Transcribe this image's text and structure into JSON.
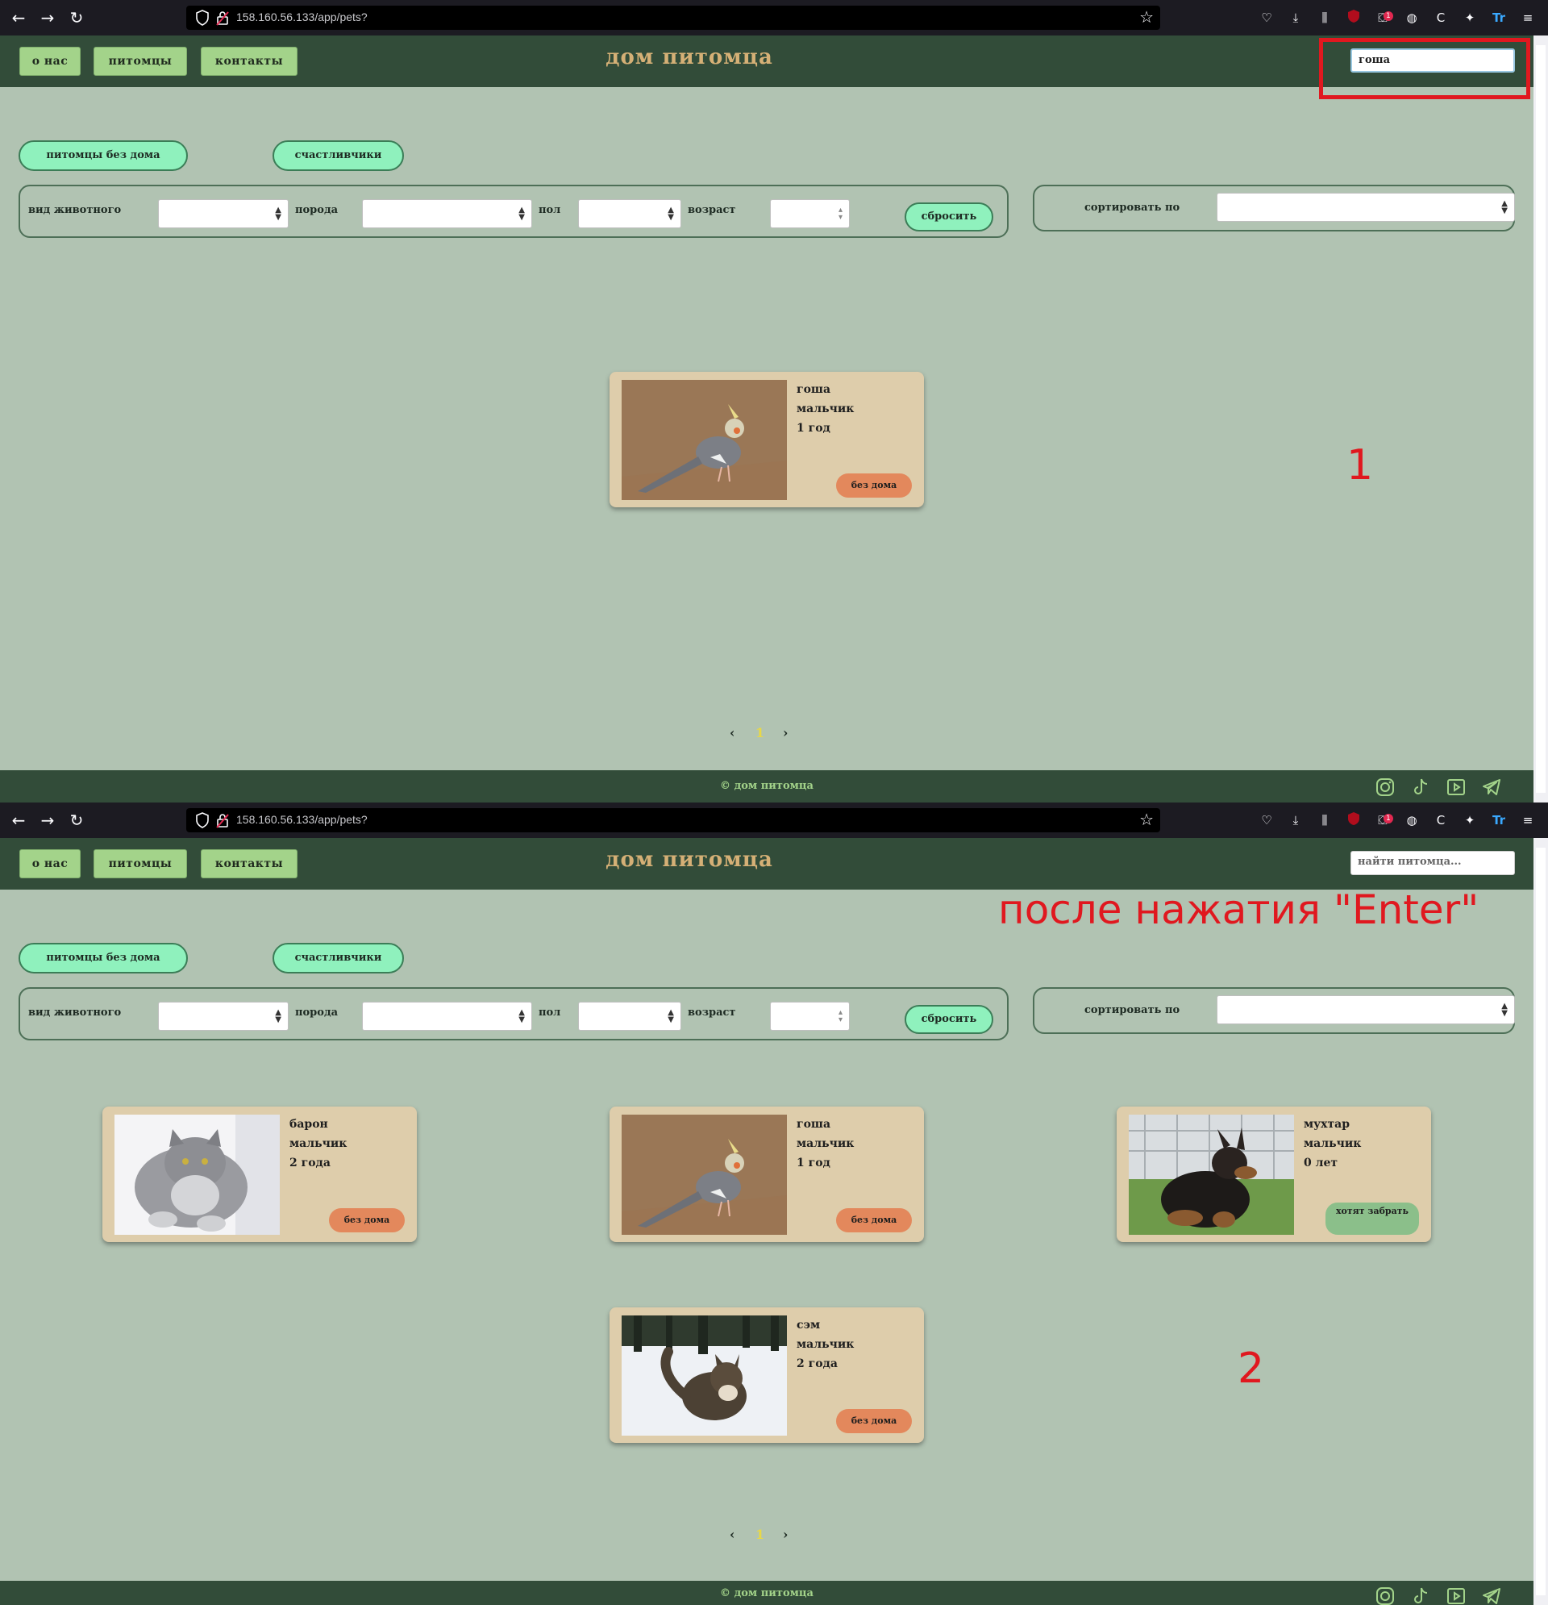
{
  "browser": {
    "url": "158.160.56.133/app/pets?",
    "extension_badge": "1"
  },
  "site": {
    "title": "дом питомца",
    "nav": [
      "о нас",
      "питомцы",
      "контакты"
    ],
    "tabs": [
      "питомцы без дома",
      "счастливчики"
    ],
    "filters": {
      "animal_type_label": "вид животного",
      "breed_label": "порода",
      "sex_label": "пол",
      "age_label": "возраст",
      "reset_label": "сбросить"
    },
    "sort_label": "сортировать по",
    "pager": {
      "prev": "‹",
      "current": "1",
      "next": "›"
    },
    "footer": "© дом питомца",
    "social_icons": [
      "instagram-icon",
      "tiktok-icon",
      "youtube-icon",
      "telegram-icon"
    ]
  },
  "panel1": {
    "search_value": "гоша",
    "annotation": "1",
    "cards": [
      {
        "name": "гоша",
        "sex": "мальчик",
        "age": "1 год",
        "status": "без дома",
        "image": "cockatiel"
      }
    ]
  },
  "panel2": {
    "search_placeholder": "найти питомца...",
    "annotation_title": "после нажатия \"Enter\"",
    "annotation": "2",
    "cards": [
      {
        "name": "барон",
        "sex": "мальчик",
        "age": "2 года",
        "status": "без дома",
        "image": "fluffy-cat"
      },
      {
        "name": "гоша",
        "sex": "мальчик",
        "age": "1 год",
        "status": "без дома",
        "image": "cockatiel"
      },
      {
        "name": "мухтар",
        "sex": "мальчик",
        "age": "0 лет",
        "status": "хотят забрать",
        "image": "shepherd-puppy"
      },
      {
        "name": "сэм",
        "sex": "мальчик",
        "age": "2 года",
        "status": "без дома",
        "image": "cat-in-snow"
      }
    ]
  },
  "colors": {
    "header": "#324c39",
    "page_bg": "#b1c3b2",
    "card_bg": "#decdab",
    "status_homeless": "#e3885c",
    "status_wanted": "#8bbf8a",
    "pill_bg": "#8ff1bd",
    "annotation": "#e0181f"
  }
}
